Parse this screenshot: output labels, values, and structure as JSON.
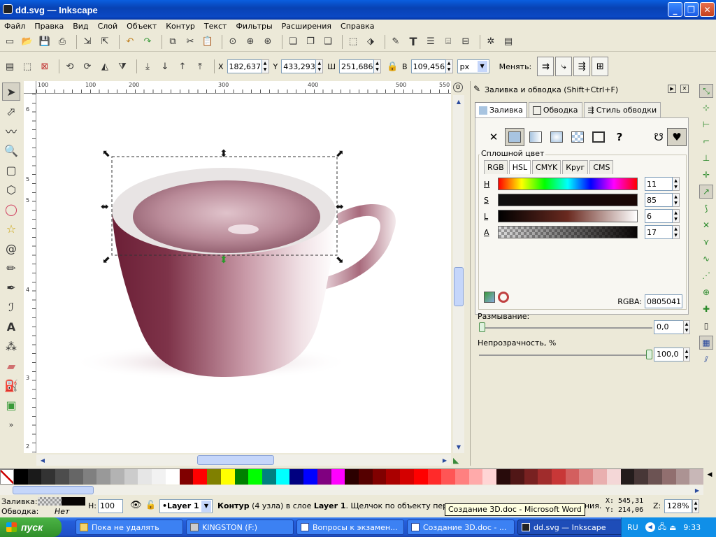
{
  "window": {
    "title": "dd.svg — Inkscape",
    "buttons": [
      "_",
      "❐",
      "✕"
    ]
  },
  "menu": [
    "Файл",
    "Правка",
    "Вид",
    "Слой",
    "Объект",
    "Контур",
    "Текст",
    "Фильтры",
    "Расширения",
    "Справка"
  ],
  "controls": {
    "x_label": "X",
    "x_value": "182,637",
    "y_label": "Y",
    "y_value": "433,293",
    "w_label": "Ш",
    "w_value": "251,686",
    "h_label": "В",
    "h_value": "109,456",
    "units": "px",
    "change_label": "Менять:"
  },
  "ruler": {
    "h_ticks": [
      "100",
      "100",
      "200",
      "300",
      "400",
      "500",
      "550"
    ],
    "v_ticks": [
      "6",
      "5",
      "5",
      "4",
      "3",
      "2"
    ]
  },
  "dock": {
    "title": "Заливка и обводка (Shift+Ctrl+F)",
    "tabs": [
      "Заливка",
      "Обводка",
      "Стиль обводки"
    ],
    "solid_title": "Сплошной цвет",
    "modes": [
      "RGB",
      "HSL",
      "CMYK",
      "Круг",
      "CMS"
    ],
    "hsl": [
      {
        "label": "H",
        "value": "11"
      },
      {
        "label": "S",
        "value": "85"
      },
      {
        "label": "L",
        "value": "6"
      },
      {
        "label": "A",
        "value": "17"
      }
    ],
    "rgba_label": "RGBA:",
    "rgba_value": "08050411",
    "blur_label": "Размывание:",
    "blur_value": "0,0",
    "blur_fraction": 0.0,
    "opacity_label": "Непрозрачность, %",
    "opacity_value": "100,0",
    "opacity_fraction": 1.0
  },
  "palette": [
    "#000000",
    "#1a1a1a",
    "#333333",
    "#4d4d4d",
    "#666666",
    "#808080",
    "#999999",
    "#b3b3b3",
    "#cccccc",
    "#e6e6e6",
    "#f2f2f2",
    "#ffffff",
    "#800000",
    "#ff0000",
    "#808000",
    "#ffff00",
    "#008000",
    "#00ff00",
    "#008080",
    "#00ffff",
    "#000080",
    "#0000ff",
    "#800080",
    "#ff00ff",
    "#2b0000",
    "#550000",
    "#800000",
    "#aa0000",
    "#d40000",
    "#ff0000",
    "#ff2a2a",
    "#ff5555",
    "#ff8080",
    "#ffaaaa",
    "#ffd5d5",
    "#280b0b",
    "#501616",
    "#782121",
    "#a02c2c",
    "#c83737",
    "#d35f5f",
    "#de8787",
    "#e9afaf",
    "#f4d7d7",
    "#241c1c",
    "#483737",
    "#6c5353",
    "#916f6f",
    "#ac9393",
    "#c8b7b7"
  ],
  "status": {
    "fill_label": "Заливка:",
    "stroke_label": "Обводка:",
    "stroke_value": "Нет",
    "h_label": "Н:",
    "h_value": "100",
    "layer": "•Layer 1",
    "message_prefix": "Контур",
    "message_mid": " (4 узла) в слое ",
    "message_layer": "Layer 1",
    "message_rest": ". Щелчок по объекту переключ",
    "message_tail": "ащения.",
    "cursor_x_label": "X:",
    "cursor_x": "545,31",
    "cursor_y_label": "Y:",
    "cursor_y": "214,06",
    "zoom_label": "Z:",
    "zoom": "128%"
  },
  "tooltip": "Создание 3D.doc - Microsoft Word",
  "taskbar": {
    "start": "пуск",
    "tasks": [
      {
        "label": "Пока не удалять",
        "active": false
      },
      {
        "label": "KINGSTON (F:)",
        "active": false
      },
      {
        "label": "Вопросы к экзамен...",
        "active": false
      },
      {
        "label": "Создание 3D.doc - ...",
        "active": false
      },
      {
        "label": "dd.svg — Inkscape",
        "active": true
      }
    ],
    "lang": "RU",
    "time": "9:33"
  }
}
